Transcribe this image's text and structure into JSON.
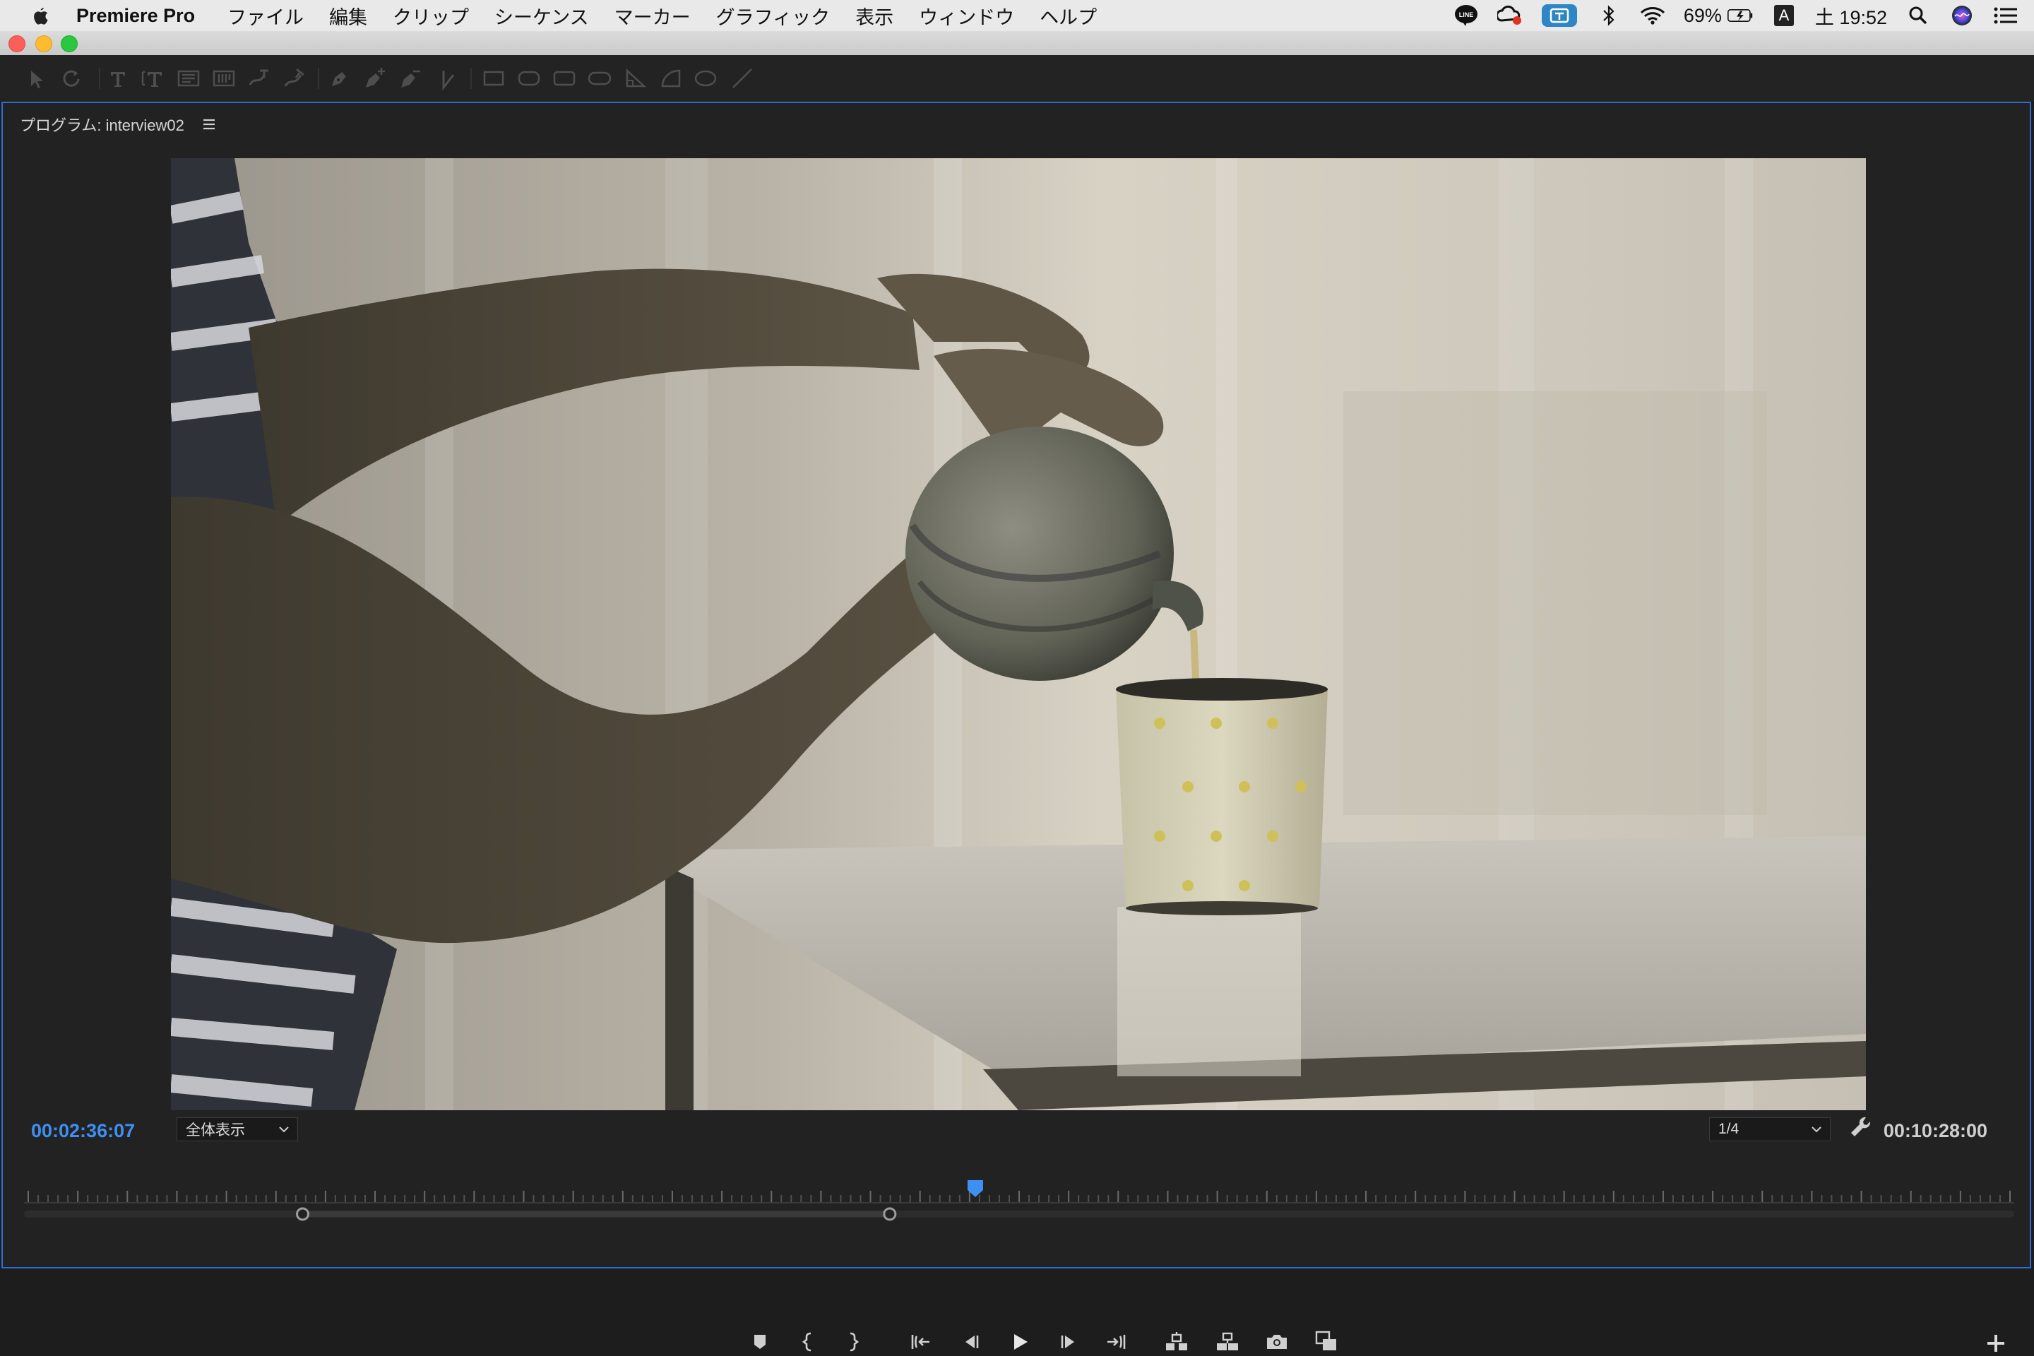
{
  "menubar": {
    "app_name": "Premiere Pro",
    "menus": [
      "ファイル",
      "編集",
      "クリップ",
      "シーケンス",
      "マーカー",
      "グラフィック",
      "表示",
      "ウィンドウ",
      "ヘルプ"
    ],
    "battery": "69%",
    "input_source": "A",
    "clock": "土 19:52"
  },
  "panel": {
    "title": "プログラム: interview02"
  },
  "monitor": {
    "current_timecode": "00:02:36:07",
    "duration_timecode": "00:10:28:00",
    "zoom_level": "全体表示",
    "playback_resolution": "1/4"
  },
  "timeline": {
    "playhead_position": 0.478,
    "in_handle_position": 0.14,
    "out_handle_position": 0.435
  },
  "colors": {
    "accent": "#3f8ff2",
    "panel_border": "#2d6cd1",
    "panel_bg": "#222222"
  },
  "icons": {
    "toolbar": [
      "selection-icon",
      "rotate-icon",
      "type-icon",
      "vertical-type-icon",
      "area-type-icon",
      "vertical-area-type-icon",
      "path-type-icon",
      "vertical-path-type-icon",
      "pen-icon",
      "add-anchor-icon",
      "delete-anchor-icon",
      "convert-anchor-icon",
      "rectangle-icon",
      "rounded-rect-icon",
      "rounded-rect2-icon",
      "clipped-rect-icon",
      "wedge-icon",
      "arc-icon",
      "ellipse-icon",
      "line-icon"
    ],
    "transport": [
      "add-marker-icon",
      "mark-in-icon",
      "mark-out-icon",
      "go-to-in-icon",
      "step-back-icon",
      "play-icon",
      "step-forward-icon",
      "go-to-out-icon",
      "lift-icon",
      "extract-icon",
      "export-frame-icon",
      "compare-view-icon"
    ]
  }
}
